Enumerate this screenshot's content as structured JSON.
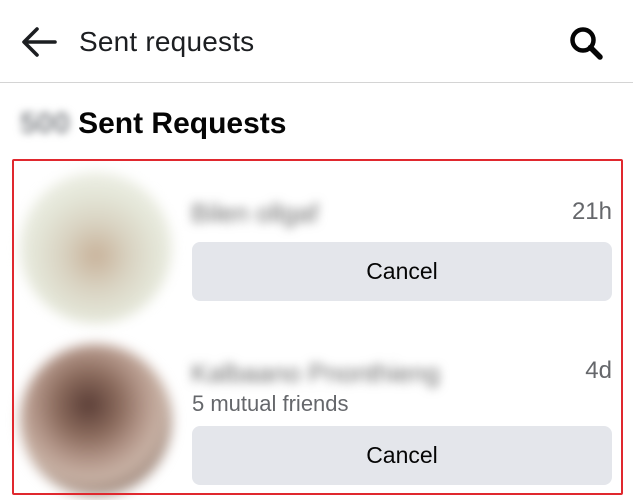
{
  "header": {
    "title": "Sent requests",
    "back_icon": "arrow-left-icon",
    "search_icon": "search-icon"
  },
  "section": {
    "count": "500",
    "title": "Sent Requests"
  },
  "colors": {
    "highlight_border": "#e0282e",
    "button_bg": "#e4e6eb",
    "secondary_text": "#65676b"
  },
  "requests": [
    {
      "name": "Bilen ollgaf",
      "time": "21h",
      "mutual": "",
      "cancel_label": "Cancel"
    },
    {
      "name": "Kalbaano Pnonthieng",
      "time": "4d",
      "mutual": "5 mutual friends",
      "cancel_label": "Cancel"
    }
  ]
}
